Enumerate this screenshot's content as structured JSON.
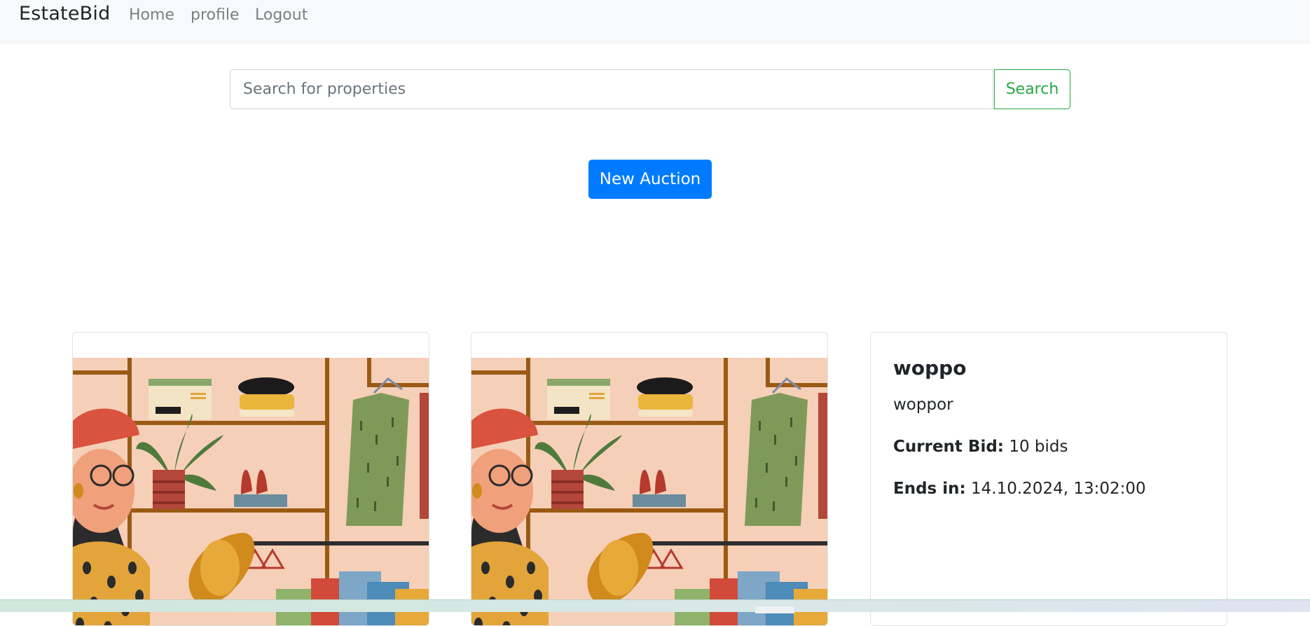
{
  "navbar": {
    "brand": "EstateBid",
    "links": [
      {
        "label": "Home"
      },
      {
        "label": "profile"
      },
      {
        "label": "Logout"
      }
    ]
  },
  "search": {
    "placeholder": "Search for properties",
    "value": "",
    "button_label": "Search"
  },
  "actions": {
    "new_auction_label": "New Auction"
  },
  "listings": [
    {
      "image": "illustration-clothing-shop"
    },
    {
      "image": "illustration-clothing-shop"
    },
    {
      "title": "woppo",
      "description": "woppor",
      "current_bid_label": "Current Bid:",
      "current_bid_value": "10 bids",
      "ends_in_label": "Ends in:",
      "ends_in_value": "14.10.2024, 13:02:00"
    }
  ],
  "colors": {
    "primary": "#007bff",
    "success": "#28a745",
    "navbar_bg": "#f8f9fa"
  }
}
